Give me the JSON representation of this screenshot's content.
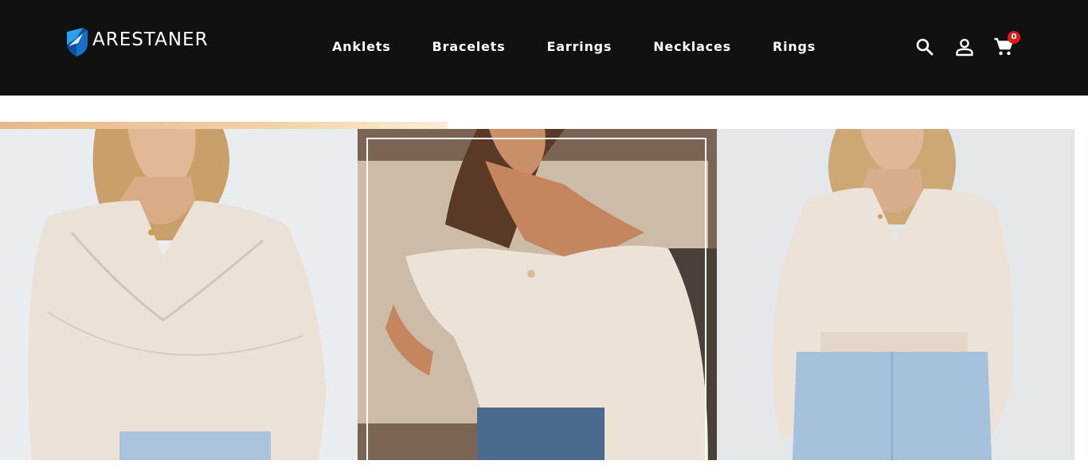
{
  "brand": {
    "name": "ARESTANER",
    "logo_icon": "shield-logo-icon",
    "colors": {
      "header_bg": "#111111",
      "logo_blue": "#1f8fe0",
      "badge_red": "#e01b1b"
    }
  },
  "nav": {
    "items": [
      {
        "label": "Anklets"
      },
      {
        "label": "Bracelets"
      },
      {
        "label": "Earrings"
      },
      {
        "label": "Necklaces"
      },
      {
        "label": "Rings"
      }
    ]
  },
  "header_icons": {
    "search": "search-icon",
    "account": "account-icon",
    "cart": "cart-icon",
    "cart_count": "0"
  },
  "products": [
    {
      "image": "woman in cream off-shoulder knit sweater, white background"
    },
    {
      "image": "woman in cream knit sweater leaning on beige sofa"
    },
    {
      "image": "woman in cream wrap sweater with light jeans"
    }
  ]
}
